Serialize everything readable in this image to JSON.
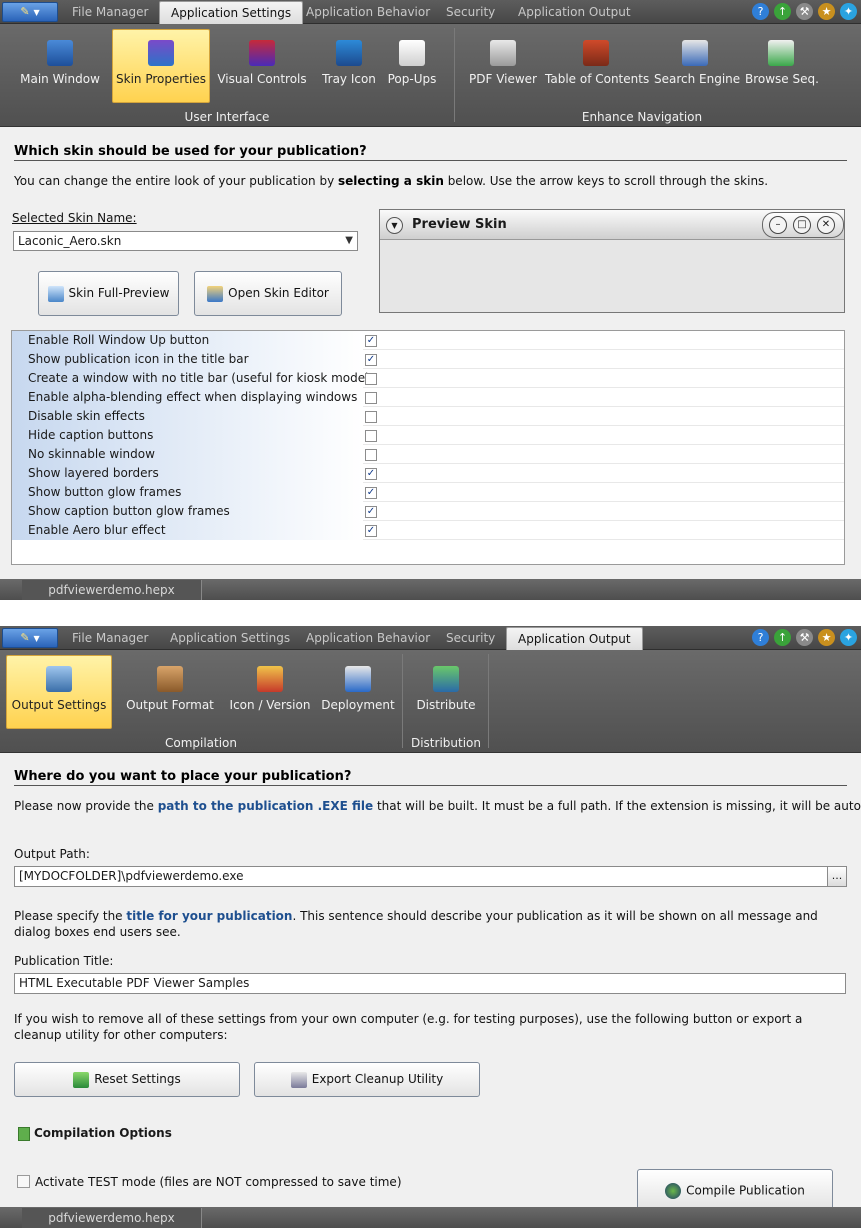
{
  "colors": {
    "ribbon_bg": "#5a5a5a",
    "selected_button": "#ffd24f",
    "link_text": "#1e4f8f",
    "list_row_gradient": "#c7d8ef"
  },
  "top_icons": [
    "help-icon",
    "up-arrow-icon",
    "tools-icon",
    "award-icon",
    "twitter-icon"
  ],
  "panel1": {
    "tabs": [
      "File Manager",
      "Application Settings",
      "Application Behavior",
      "Security",
      "Application Output"
    ],
    "active_tab": "Application Settings",
    "ribbon": {
      "groups": [
        {
          "label": "User Interface",
          "items": [
            "Main Window",
            "Skin Properties",
            "Visual Controls",
            "Tray Icon",
            "Pop-Ups"
          ]
        },
        {
          "label": "Enhance Navigation",
          "items": [
            "PDF Viewer",
            "Table of Contents",
            "Search Engine",
            "Browse Seq."
          ]
        }
      ],
      "selected": "Skin Properties"
    },
    "heading": "Which skin should be used for your publication?",
    "intro_pre": "You can change the entire look of your publication by ",
    "intro_bold": "selecting a skin",
    "intro_post": " below. Use the arrow keys to scroll through the skins.",
    "skin_label": "Selected Skin Name:",
    "skin_value": "Laconic_Aero.skn",
    "btn_full_preview": "Skin Full-Preview",
    "btn_open_editor": "Open Skin Editor",
    "preview_title": "Preview Skin",
    "options": [
      {
        "label": "Enable Roll Window Up button",
        "checked": true
      },
      {
        "label": "Show publication icon in the title bar",
        "checked": true
      },
      {
        "label": "Create a window with no title bar (useful for kiosk mode)",
        "checked": false
      },
      {
        "label": "Enable alpha-blending effect when displaying windows",
        "checked": false
      },
      {
        "label": "Disable skin effects",
        "checked": false
      },
      {
        "label": "Hide caption buttons",
        "checked": false
      },
      {
        "label": "No skinnable window",
        "checked": false
      },
      {
        "label": "Show layered borders",
        "checked": true
      },
      {
        "label": "Show button glow frames",
        "checked": true
      },
      {
        "label": "Show caption button glow frames",
        "checked": true
      },
      {
        "label": "Enable Aero blur effect",
        "checked": true
      }
    ],
    "status_file": "pdfviewerdemo.hepx"
  },
  "panel2": {
    "tabs": [
      "File Manager",
      "Application Settings",
      "Application Behavior",
      "Security",
      "Application Output"
    ],
    "active_tab": "Application Output",
    "ribbon": {
      "groups": [
        {
          "label": "Compilation",
          "items": [
            "Output Settings",
            "Output Format",
            "Icon / Version",
            "Deployment"
          ]
        },
        {
          "label": "Distribution",
          "items": [
            "Distribute"
          ]
        }
      ],
      "selected": "Output Settings"
    },
    "heading": "Where do you want to place your publication?",
    "intro_pre": "Please now provide the ",
    "intro_link": "path to the publication .EXE file",
    "intro_post": " that will be built. It must be a full path. If the extension is missing, it will be automatically added.",
    "output_path_label": "Output Path:",
    "output_path_value": "[MYDOCFOLDER]\\pdfviewerdemo.exe",
    "browse_label": "...",
    "title_pre": "Please specify the ",
    "title_link": "title for your publication",
    "title_post": ". This sentence should describe your publication as it will be shown on all message and dialog boxes end users see.",
    "pub_title_label": "Publication Title:",
    "pub_title_value": "HTML Executable PDF Viewer Samples",
    "remove_text": "If you wish to remove all of these settings from your own computer (e.g. for testing purposes), use the following button or export a cleanup utility for other computers:",
    "btn_reset": "Reset Settings",
    "btn_export": "Export Cleanup Utility",
    "compilation_options": "Compilation Options",
    "test_mode_label": "Activate TEST mode (files are NOT compressed to save time)",
    "test_mode_checked": false,
    "btn_compile": "Compile Publication",
    "status_file": "pdfviewerdemo.hepx"
  }
}
